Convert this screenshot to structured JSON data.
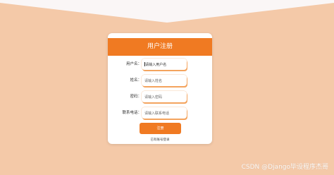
{
  "colors": {
    "background": "#f4c9a8",
    "background_top": "#faf6f6",
    "accent": "#f07a22"
  },
  "form": {
    "title": "用户注册",
    "fields": [
      {
        "label": "用户名：",
        "placeholder": "请输入用户名"
      },
      {
        "label": "姓名：",
        "placeholder": "请输入姓名"
      },
      {
        "label": "密码：",
        "placeholder": "请输入密码"
      },
      {
        "label": "联系电话：",
        "placeholder": "请输入联系电话"
      }
    ],
    "submit_label": "注册",
    "login_link": "已有账号登录"
  },
  "watermark": "CSDN @Django毕设程序杰哥"
}
